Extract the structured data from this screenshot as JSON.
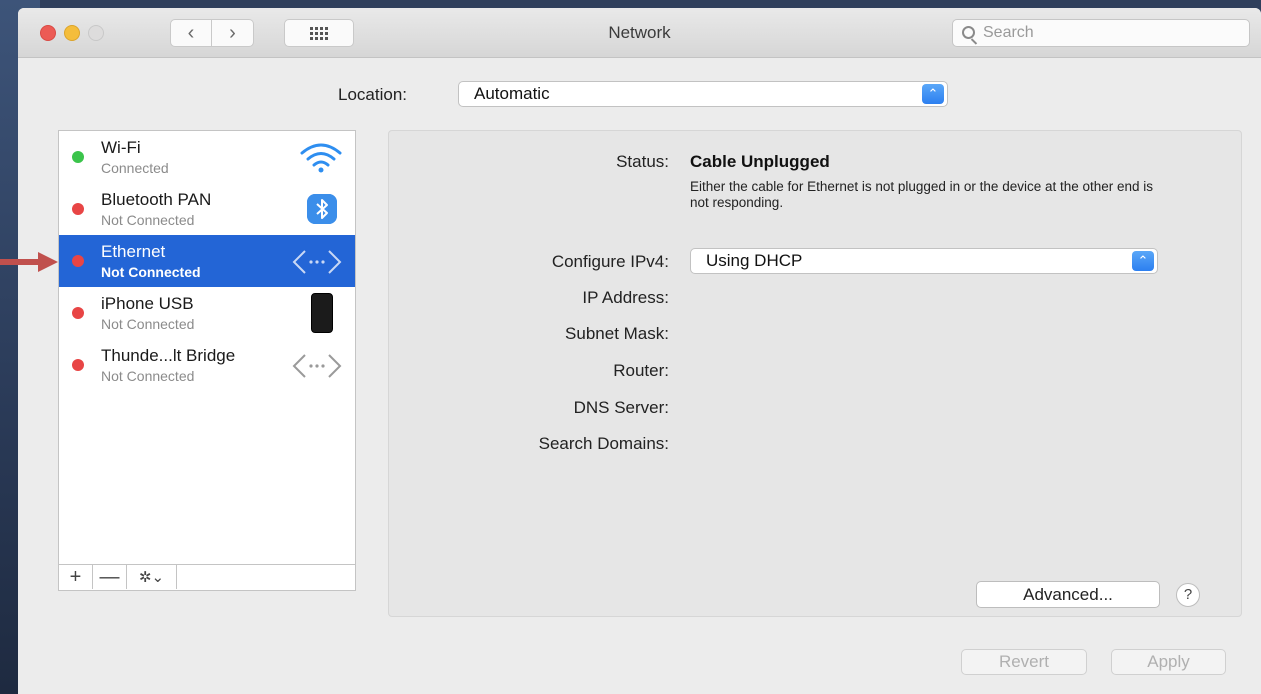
{
  "window": {
    "title": "Network",
    "search_placeholder": "Search"
  },
  "location": {
    "label": "Location:",
    "value": "Automatic"
  },
  "services": [
    {
      "name": "Wi-Fi",
      "status": "Connected",
      "dot_color": "#3bc44b",
      "icon": "wifi-icon"
    },
    {
      "name": "Bluetooth PAN",
      "status": "Not Connected",
      "dot_color": "#e84545",
      "icon": "bluetooth-icon"
    },
    {
      "name": "Ethernet",
      "status": "Not Connected",
      "dot_color": "#e84545",
      "icon": "ethernet-arrows-icon",
      "selected": true
    },
    {
      "name": "iPhone USB",
      "status": "Not Connected",
      "dot_color": "#e84545",
      "icon": "iphone-icon"
    },
    {
      "name": "Thunde...lt Bridge",
      "status": "Not Connected",
      "dot_color": "#e84545",
      "icon": "thunderbolt-arrows-icon"
    }
  ],
  "sidebar_tools": {
    "add": "+",
    "remove": "—",
    "gear": "✲⌄"
  },
  "details": {
    "status_label": "Status:",
    "status_value": "Cable Unplugged",
    "status_description": "Either the cable for Ethernet is not plugged in or the device at the other end is not responding.",
    "configure_label": "Configure IPv4:",
    "configure_value": "Using DHCP",
    "ip_label": "IP Address:",
    "subnet_label": "Subnet Mask:",
    "router_label": "Router:",
    "dns_label": "DNS Server:",
    "search_domains_label": "Search Domains:"
  },
  "buttons": {
    "advanced": "Advanced...",
    "help": "?",
    "revert": "Revert",
    "apply": "Apply"
  },
  "colors": {
    "selection": "#2365d6",
    "accent": "#2c7ff0",
    "annotation_arrow": "#c0504d"
  }
}
